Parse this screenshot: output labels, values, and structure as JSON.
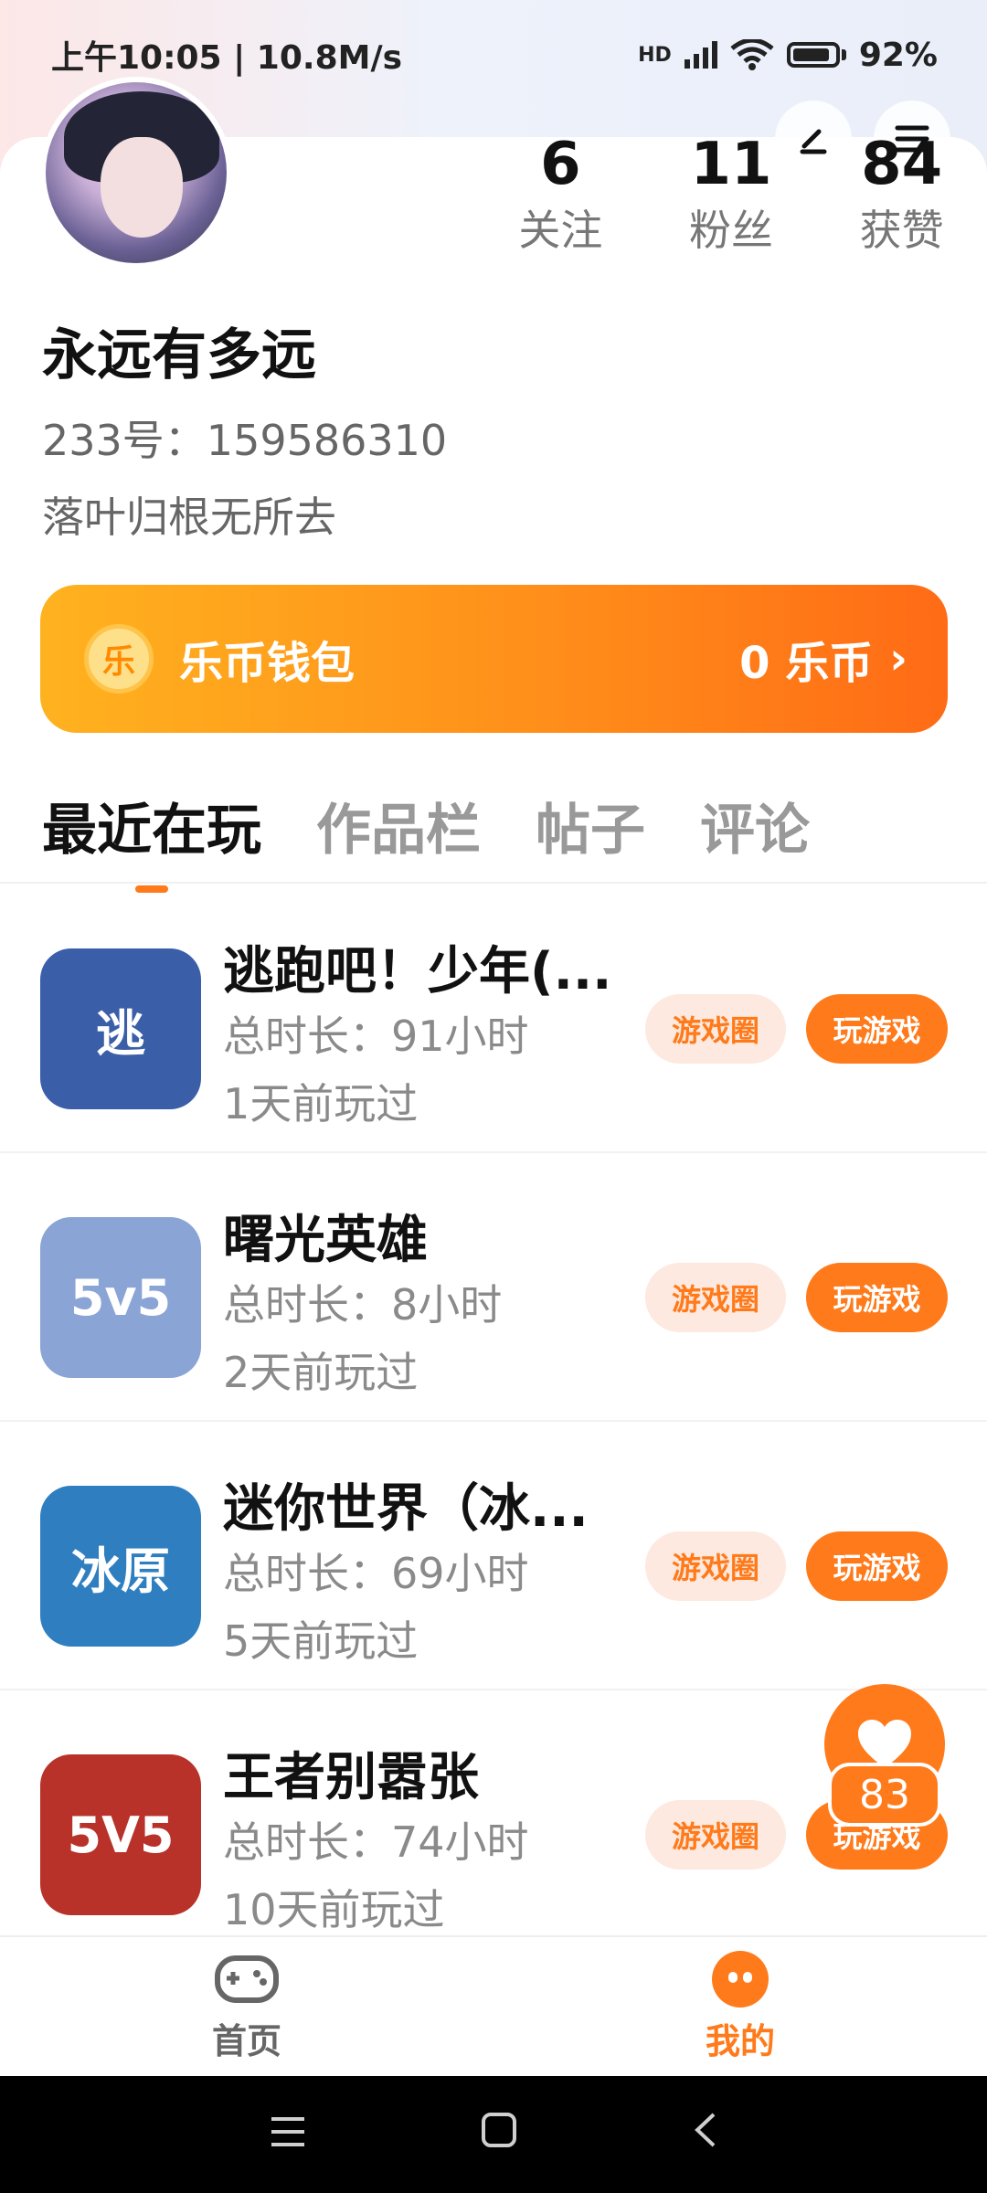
{
  "status_bar": {
    "time_speed": "上午10:05 | 10.8M/s",
    "network": "HD",
    "battery": "92%"
  },
  "profile": {
    "stats": [
      {
        "value": "6",
        "label": "关注"
      },
      {
        "value": "11",
        "label": "粉丝"
      },
      {
        "value": "84",
        "label": "获赞"
      }
    ],
    "nickname": "永远有多远",
    "uid": "233号：159586310",
    "bio": "落叶归根无所去"
  },
  "wallet": {
    "coin_symbol": "乐",
    "title": "乐币钱包",
    "amount": "0 乐币",
    "chevron": "›"
  },
  "tabs": [
    "最近在玩",
    "作品栏",
    "帖子",
    "评论"
  ],
  "games": [
    {
      "title": "逃跑吧！少年(...",
      "time": "总时长：91小时",
      "last": "1天前玩过",
      "circle": "游戏圈",
      "play": "玩游戏",
      "icon_text": "逃",
      "icon_color": "#3a5fa8"
    },
    {
      "title": "曙光英雄",
      "time": "总时长：8小时",
      "last": "2天前玩过",
      "circle": "游戏圈",
      "play": "玩游戏",
      "icon_text": "5v5",
      "icon_color": "#8aa4d6"
    },
    {
      "title": "迷你世界（冰...",
      "time": "总时长：69小时",
      "last": "5天前玩过",
      "circle": "游戏圈",
      "play": "玩游戏",
      "icon_text": "冰原",
      "icon_color": "#2f7fc0"
    },
    {
      "title": "王者别嚣张",
      "time": "总时长：74小时",
      "last": "10天前玩过",
      "circle": "游戏圈",
      "play": "玩游戏",
      "icon_text": "5V5",
      "icon_color": "#b8322a"
    }
  ],
  "float_heart": {
    "count": "83"
  },
  "bottom_nav": [
    {
      "label": "首页",
      "icon": "gamepad-icon"
    },
    {
      "label": "我的",
      "icon": "me-icon"
    }
  ],
  "colors": {
    "accent": "#ff7a1a",
    "wallet_start": "#ffb21f",
    "wallet_end": "#ff6b16"
  }
}
